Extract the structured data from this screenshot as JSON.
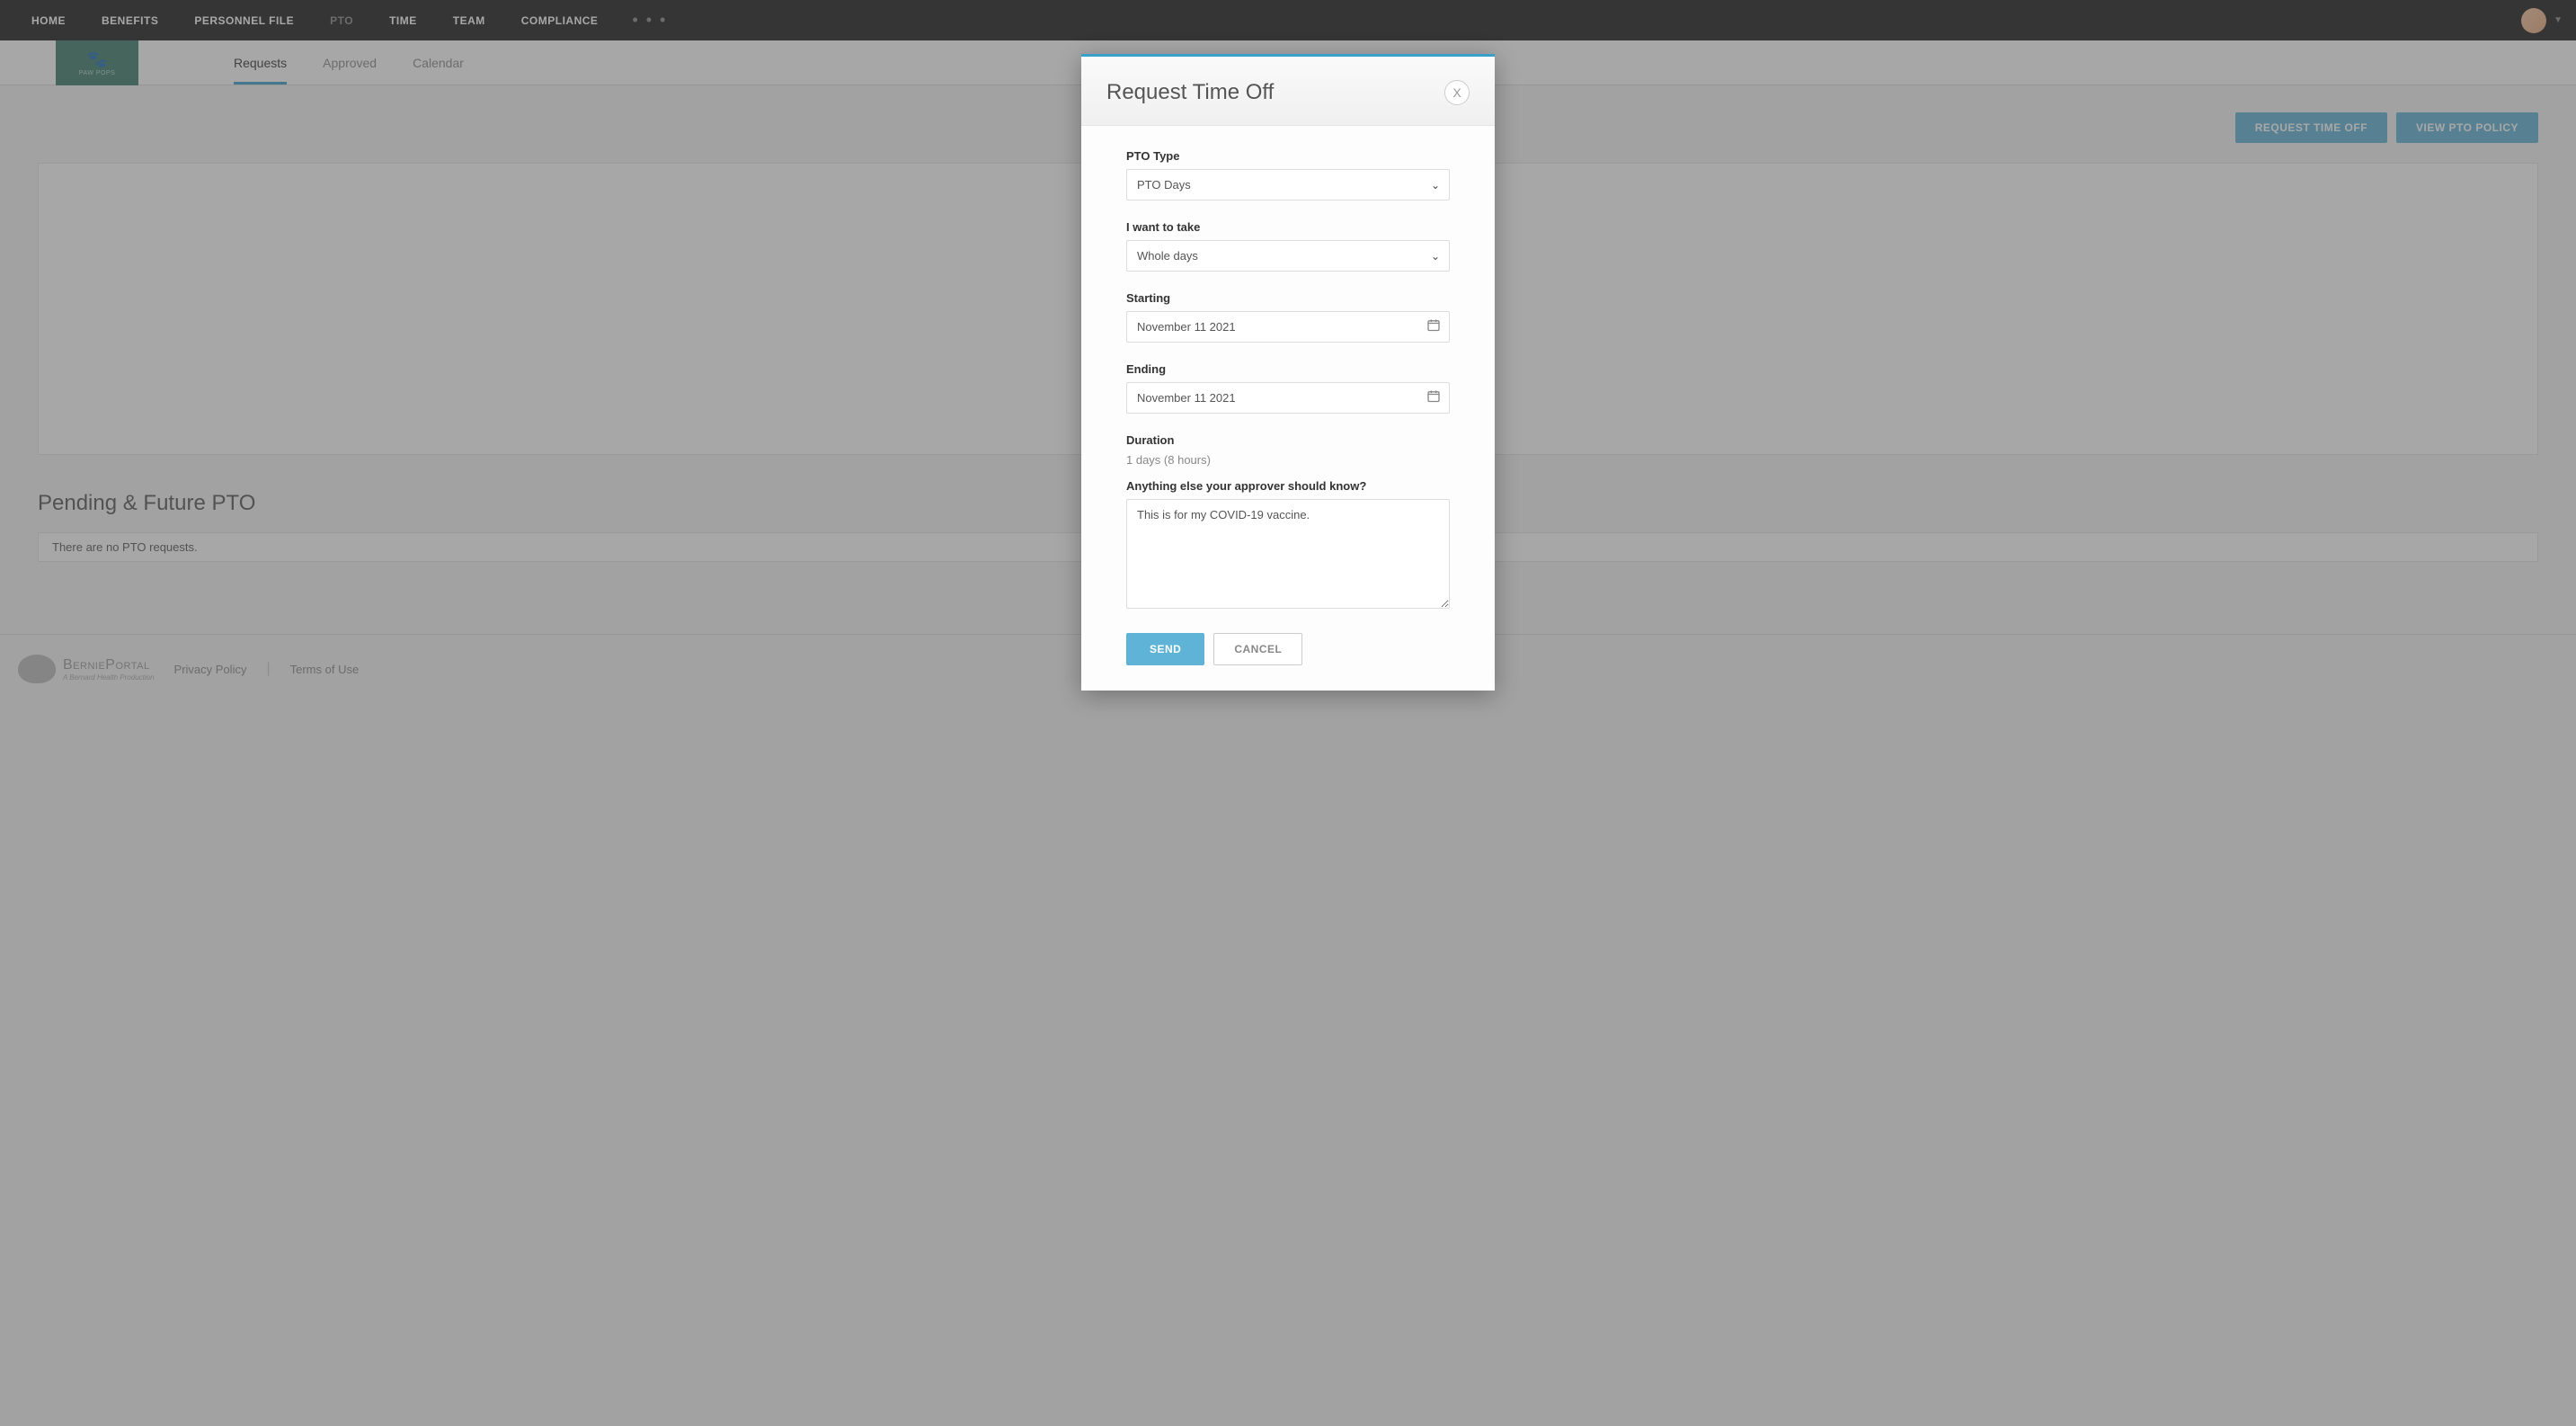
{
  "topnav": {
    "items": [
      "HOME",
      "BENEFITS",
      "PERSONNEL FILE",
      "PTO",
      "TIME",
      "TEAM",
      "COMPLIANCE"
    ],
    "active_index": 3
  },
  "logo": {
    "name": "PAW POPS"
  },
  "tabs": {
    "items": [
      "Requests",
      "Approved",
      "Calendar"
    ],
    "active_index": 0
  },
  "actions": {
    "request": "REQUEST TIME OFF",
    "policy": "VIEW PTO POLICY"
  },
  "pending": {
    "title": "Pending & Future PTO",
    "empty": "There are no PTO requests."
  },
  "footer": {
    "brand": "BerniePortal",
    "tagline": "A Bernard Health Production",
    "privacy": "Privacy Policy",
    "terms": "Terms of Use"
  },
  "modal": {
    "title": "Request Time Off",
    "fields": {
      "pto_type": {
        "label": "PTO Type",
        "value": "PTO Days"
      },
      "take": {
        "label": "I want to take",
        "value": "Whole days"
      },
      "starting": {
        "label": "Starting",
        "value": "November 11 2021"
      },
      "ending": {
        "label": "Ending",
        "value": "November 11 2021"
      },
      "duration": {
        "label": "Duration",
        "value": "1 days (8 hours)"
      },
      "notes": {
        "label": "Anything else your approver should know?",
        "value": "This is for my COVID-19 vaccine."
      }
    },
    "buttons": {
      "send": "SEND",
      "cancel": "CANCEL"
    }
  }
}
